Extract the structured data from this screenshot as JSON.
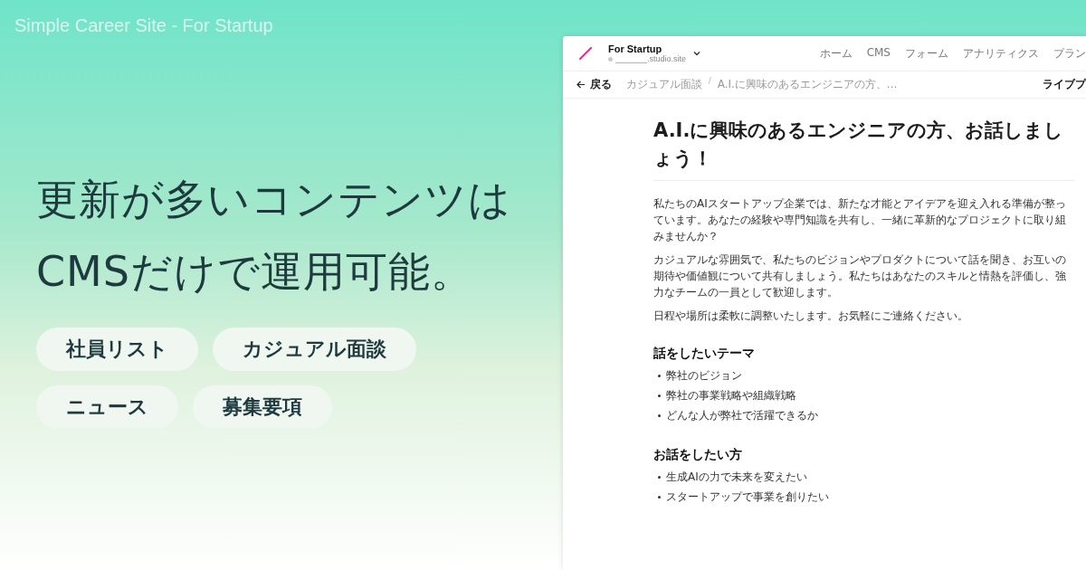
{
  "page_title": "Simple Career Site - For Startup",
  "headline": [
    "更新が多いコンテンツは",
    "CMSだけで運用可能。"
  ],
  "tags": [
    [
      "社員リスト",
      "カジュアル面談"
    ],
    [
      "ニュース",
      "募集要項"
    ]
  ],
  "app": {
    "site_name": "For Startup",
    "site_url": "_______.studio.site",
    "nav": [
      {
        "label": "ホーム",
        "selected": false
      },
      {
        "label": "CMS",
        "selected": false
      },
      {
        "label": "フォーム",
        "selected": false
      },
      {
        "label": "アナリティクス",
        "selected": false
      },
      {
        "label": "プラン",
        "selected": false
      }
    ],
    "back": "戻る",
    "breadcrumb": [
      "カジュアル面談",
      "A.I.に興味のあるエンジニアの方、..."
    ],
    "separator": "/",
    "right_action": "ライブプ"
  },
  "article": {
    "title": "A.I.に興味のあるエンジニアの方、お話しましょう！",
    "paragraphs": [
      "私たちのAIスタートアップ企業では、新たな才能とアイデアを迎え入れる準備が整っています。あなたの経験や専門知識を共有し、一緒に革新的なプロジェクトに取り組みませんか？",
      "カジュアルな雰囲気で、私たちのビジョンやプロダクトについて話を聞き、お互いの期待や価値観について共有しましょう。私たちはあなたのスキルと情熱を評価し、強力なチームの一員として歓迎します。",
      "日程や場所は柔軟に調整いたします。お気軽にご連絡ください。"
    ],
    "sections": [
      {
        "heading": "話をしたいテーマ",
        "items": [
          "弊社のビジョン",
          "弊社の事業戦略や組織戦略",
          "どんな人が弊社で活躍できるか"
        ]
      },
      {
        "heading": "お話をしたい方",
        "items": [
          "生成AIの力で未来を変えたい",
          "スタートアップで事業を創りたい"
        ]
      }
    ]
  }
}
